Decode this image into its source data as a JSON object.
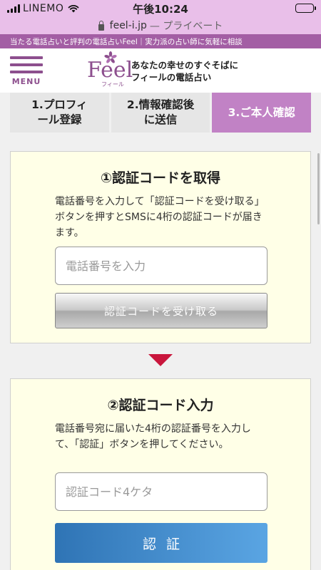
{
  "status_bar": {
    "carrier": "LINEMO",
    "time": "午後10:24"
  },
  "browser": {
    "url": "feel-i.jp",
    "private_label": "— プライベート"
  },
  "site": {
    "tagline": "当たる電話占いと評判の電話占いFeel｜実力派の占い師に気軽に相談",
    "menu_label": "MENU",
    "logo_text": "Feel",
    "logo_sub": "フィール",
    "slogan_line1": "あなたの幸せのすぐそばに",
    "slogan_line2": "フィールの電話占い"
  },
  "steps": [
    {
      "line1": "1.プロフィ",
      "line2": "ール登録"
    },
    {
      "line1": "2.情報確認後",
      "line2": "に送信"
    },
    {
      "line1": "3.ご本人確認",
      "line2": ""
    }
  ],
  "section1": {
    "title": "①認証コードを取得",
    "description": "電話番号を入力して「認証コードを受け取る」ボタンを押すとSMSに4桁の認証コードが届きます。",
    "input_placeholder": "電話番号を入力",
    "button_label": "認証コードを受け取る"
  },
  "section2": {
    "title": "②認証コード入力",
    "description": "電話番号宛に届いた4桁の認証番号を入力して、「認証」ボタンを押してください。",
    "input_placeholder": "認証コード4ケタ",
    "button_label": "認証"
  },
  "colors": {
    "status_bg": "#e9bfe9",
    "brand_purple": "#a35ea4",
    "active_step": "#c182c5",
    "arrow_red": "#c9163c",
    "card_bg": "#ffffe7",
    "auth_button_blue": "#2f74b5"
  }
}
